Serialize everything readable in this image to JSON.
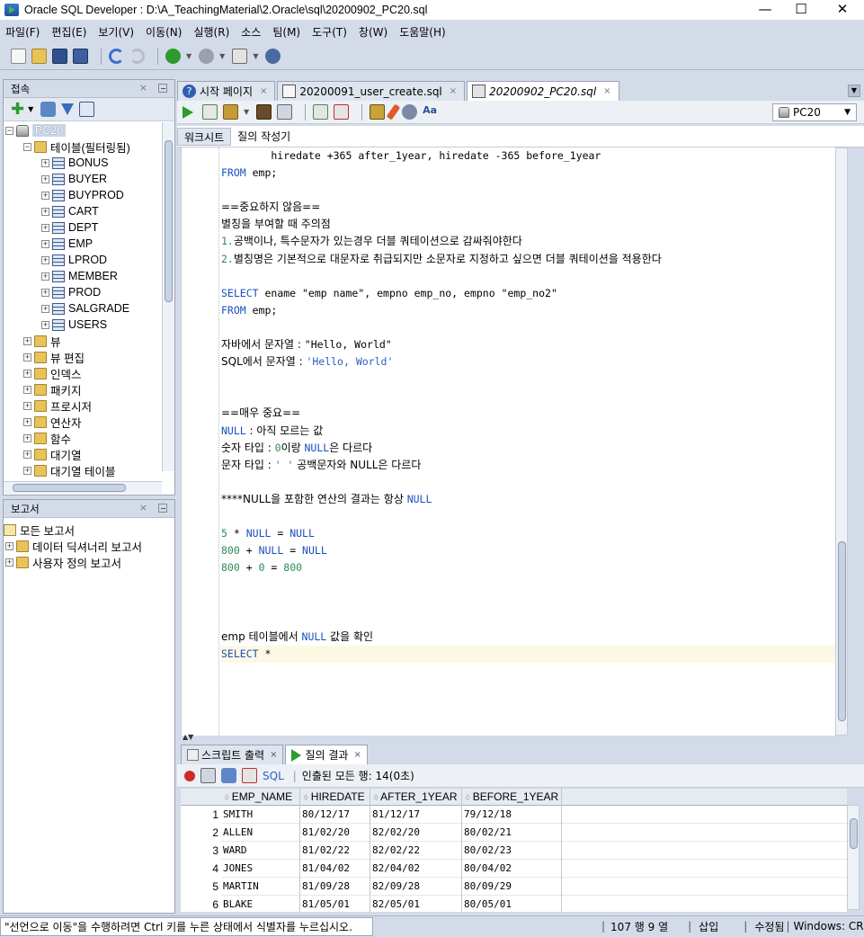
{
  "window": {
    "title": "Oracle SQL Developer : D:\\A_TeachingMaterial\\2.Oracle\\sql\\20200902_PC20.sql",
    "minimize": "—",
    "maximize": "☐",
    "close": "✕"
  },
  "menu": [
    "파일(F)",
    "편집(E)",
    "보기(V)",
    "이동(N)",
    "실행(R)",
    "소스",
    "팀(M)",
    "도구(T)",
    "창(W)",
    "도움말(H)"
  ],
  "connections_panel": {
    "title": "접속",
    "close": "×",
    "root": "PC20",
    "tables_folder": "테이블(필터링됨)",
    "tables": [
      "BONUS",
      "BUYER",
      "BUYPROD",
      "CART",
      "DEPT",
      "EMP",
      "LPROD",
      "MEMBER",
      "PROD",
      "SALGRADE",
      "USERS"
    ],
    "folders": [
      "뷰",
      "뷰 편집",
      "인덱스",
      "패키지",
      "프로시저",
      "연산자",
      "함수",
      "대기열",
      "대기열 테이블"
    ]
  },
  "reports_panel": {
    "title": "보고서",
    "close": "×",
    "items": [
      "모든 보고서",
      "데이터 딕셔너리 보고서",
      "사용자 정의 보고서"
    ]
  },
  "editor_tabs": [
    {
      "label": "시작 페이지",
      "close": "×"
    },
    {
      "label": "20200091_user_create.sql",
      "close": "×"
    },
    {
      "label": "20200902_PC20.sql",
      "close": "×"
    }
  ],
  "connection_selector": "PC20",
  "sub_tabs": [
    "워크시트",
    "질의 작성기"
  ],
  "code_lines": [
    [
      {
        "t": "        hiredate +365 after_1year, hiredate -365 before_1year",
        "c": ""
      }
    ],
    [
      {
        "t": "FROM",
        "c": "kw"
      },
      {
        "t": " emp;",
        "c": ""
      }
    ],
    [
      {
        "t": "",
        "c": ""
      }
    ],
    [
      {
        "t": "==중요하지 않음==",
        "c": "ko"
      }
    ],
    [
      {
        "t": "별칭을 부여할 때 주의점",
        "c": "ko"
      }
    ],
    [
      {
        "t": "1.",
        "c": "num"
      },
      {
        "t": "공백이나, 특수문자가 있는경우 더블 쿼테이션으로 감싸줘야한다",
        "c": "ko"
      }
    ],
    [
      {
        "t": "2.",
        "c": "num"
      },
      {
        "t": "별칭명은 기본적으로 대문자로 취급되지만 소문자로 지정하고 싶으면 더블 쿼테이션을 적용한다",
        "c": "ko"
      }
    ],
    [
      {
        "t": "",
        "c": ""
      }
    ],
    [
      {
        "t": "SELECT",
        "c": "kw"
      },
      {
        "t": " ename \"emp name\", empno emp_no, empno \"emp_no2\"",
        "c": ""
      }
    ],
    [
      {
        "t": "FROM",
        "c": "kw"
      },
      {
        "t": " emp;",
        "c": ""
      }
    ],
    [
      {
        "t": "",
        "c": ""
      }
    ],
    [
      {
        "t": "자바에서 문자열 : ",
        "c": "ko"
      },
      {
        "t": "\"Hello, World\"",
        "c": ""
      }
    ],
    [
      {
        "t": "SQL에서 문자열 : ",
        "c": "ko"
      },
      {
        "t": "'Hello, World'",
        "c": "str"
      }
    ],
    [
      {
        "t": "",
        "c": ""
      }
    ],
    [
      {
        "t": "",
        "c": ""
      }
    ],
    [
      {
        "t": "==매우 중요==",
        "c": "ko"
      }
    ],
    [
      {
        "t": "NULL",
        "c": "kw"
      },
      {
        "t": " : 아직 모르는 값",
        "c": "ko"
      }
    ],
    [
      {
        "t": "숫자 타입 : ",
        "c": "ko"
      },
      {
        "t": "0",
        "c": "num"
      },
      {
        "t": "이랑 ",
        "c": "ko"
      },
      {
        "t": "NULL",
        "c": "kw"
      },
      {
        "t": "은 다르다",
        "c": "ko"
      }
    ],
    [
      {
        "t": "문자 타입 : ",
        "c": "ko"
      },
      {
        "t": "' '",
        "c": "str"
      },
      {
        "t": " 공백문자와 NULL은 다르다",
        "c": "ko"
      }
    ],
    [
      {
        "t": "",
        "c": ""
      }
    ],
    [
      {
        "t": "****NULL을 포함한 연산의 결과는 항상 ",
        "c": "ko"
      },
      {
        "t": "NULL",
        "c": "kw"
      }
    ],
    [
      {
        "t": "",
        "c": ""
      }
    ],
    [
      {
        "t": "5",
        "c": "num"
      },
      {
        "t": " * ",
        "c": ""
      },
      {
        "t": "NULL",
        "c": "kw"
      },
      {
        "t": " = ",
        "c": ""
      },
      {
        "t": "NULL",
        "c": "kw"
      }
    ],
    [
      {
        "t": "800",
        "c": "num"
      },
      {
        "t": " + ",
        "c": ""
      },
      {
        "t": "NULL",
        "c": "kw"
      },
      {
        "t": " = ",
        "c": ""
      },
      {
        "t": "NULL",
        "c": "kw"
      }
    ],
    [
      {
        "t": "800",
        "c": "num"
      },
      {
        "t": " + ",
        "c": ""
      },
      {
        "t": "0",
        "c": "num"
      },
      {
        "t": " = ",
        "c": ""
      },
      {
        "t": "800",
        "c": "num"
      }
    ],
    [
      {
        "t": "",
        "c": ""
      }
    ],
    [
      {
        "t": "",
        "c": ""
      }
    ],
    [
      {
        "t": "",
        "c": ""
      }
    ],
    [
      {
        "t": "emp 테이블에서 ",
        "c": "ko"
      },
      {
        "t": "NULL",
        "c": "kw"
      },
      {
        "t": " 값을 확인",
        "c": "ko"
      }
    ],
    [
      {
        "t": "SELECT",
        "c": "kw"
      },
      {
        "t": " *",
        "c": ""
      }
    ],
    [
      {
        "t": "",
        "c": ""
      }
    ]
  ],
  "current_line_index": 29,
  "result_tabs": [
    {
      "label": "스크립트 출력",
      "close": "×"
    },
    {
      "label": "질의 결과",
      "close": "×"
    }
  ],
  "result_toolbar": {
    "sql_label": "SQL",
    "fetched": "인출된 모든 행: 14(0초)"
  },
  "result_grid": {
    "columns": [
      "EMP_NAME",
      "HIREDATE",
      "AFTER_1YEAR",
      "BEFORE_1YEAR"
    ],
    "rows": [
      [
        "1",
        "SMITH",
        "80/12/17",
        "81/12/17",
        "79/12/18"
      ],
      [
        "2",
        "ALLEN",
        "81/02/20",
        "82/02/20",
        "80/02/21"
      ],
      [
        "3",
        "WARD",
        "81/02/22",
        "82/02/22",
        "80/02/23"
      ],
      [
        "4",
        "JONES",
        "81/04/02",
        "82/04/02",
        "80/04/02"
      ],
      [
        "5",
        "MARTIN",
        "81/09/28",
        "82/09/28",
        "80/09/29"
      ],
      [
        "6",
        "BLAKE",
        "81/05/01",
        "82/05/01",
        "80/05/01"
      ]
    ]
  },
  "status": {
    "message": "\"선언으로 이동\"을 수행하려면 Ctrl 키를 누른 상태에서 식별자를 누르십시오.",
    "position": "107 행 9 열",
    "mode": "삽입",
    "modified": "수정됨",
    "os": "Windows: CR"
  }
}
